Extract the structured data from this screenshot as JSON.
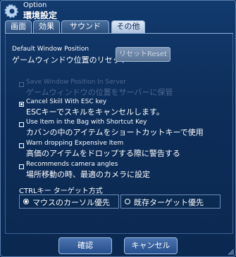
{
  "window": {
    "title_en": "Option",
    "title_jp": "環境設定"
  },
  "tabs": [
    {
      "label": "画面"
    },
    {
      "label": "効果"
    },
    {
      "label": "サウンド"
    },
    {
      "label": "その他"
    }
  ],
  "active_tab": "その他",
  "reset": {
    "label_en": "Default Window Position",
    "label_jp": "ゲームウィンドウ位置のリセット",
    "button": "リセットReset"
  },
  "options": [
    {
      "en": "Save Window Position In Server",
      "jp": "ゲームウィンドウの位置をサーバーに保管",
      "checked": false,
      "enabled": false
    },
    {
      "en": "Cancel Skill With ESC key",
      "jp": "ESCキーでスキルをキャンセルします。",
      "checked": true,
      "enabled": true
    },
    {
      "en": "Use Item in the Bag with Shortcut Key",
      "jp": "カバンの中のアイテムをショートカットキーで使用",
      "checked": false,
      "enabled": true
    },
    {
      "en": "Warn dropping Expensive Item",
      "jp": "高価のアイテムをドロップする際に警告する",
      "checked": false,
      "enabled": true
    },
    {
      "en": "Recommends camera angles",
      "jp": "場所移動の時、最適のカメラに設定",
      "checked": false,
      "enabled": true
    }
  ],
  "ctrl": {
    "title": "CTRLキー ターゲット方式",
    "choices": [
      {
        "label": "マウスのカーソル優先",
        "selected": true
      },
      {
        "label": "既存ターゲット優先",
        "selected": false
      }
    ]
  },
  "buttons": {
    "ok": "確認",
    "cancel": "キャンセル"
  },
  "colors": {
    "background": "#0c2a52",
    "accent": "#8fb0d8",
    "disabled_text": "#4d6a90"
  }
}
